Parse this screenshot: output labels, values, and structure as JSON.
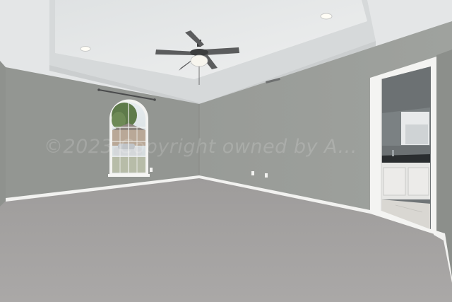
{
  "scene": {
    "subject": "empty bedroom with tray ceiling, ceiling fan, arched window and doorway to bathroom",
    "watermark_text": "©2023 Copyright owned by A..."
  },
  "colors": {
    "wall": "#9a9d99",
    "wall_left": "#939692",
    "ceiling": "#e7e9e9",
    "tray": "#d9dcdd",
    "carpet": "#a4a2a1",
    "trim": "#f4f4f2",
    "cabinet": "#e6e6e4",
    "countertop": "#2a2d2f"
  }
}
